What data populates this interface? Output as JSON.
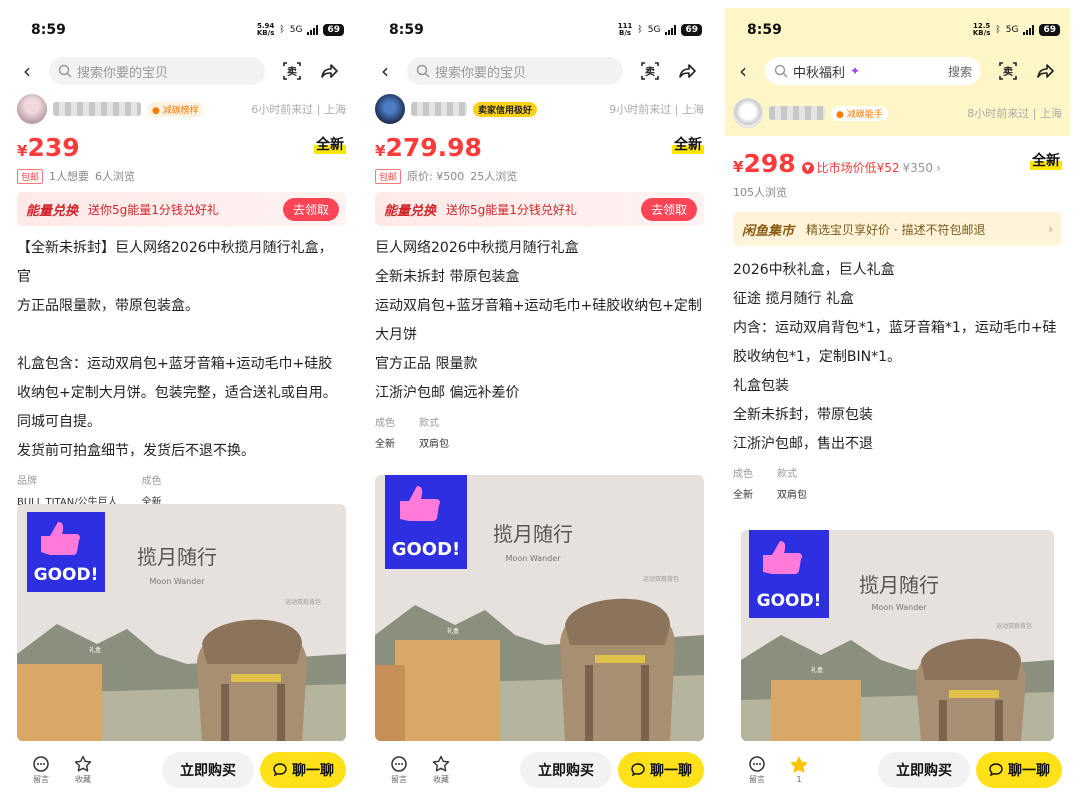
{
  "panels": [
    {
      "status": {
        "time": "8:59",
        "speed": "5.94",
        "speed_unit": "KB/s",
        "battery": "69",
        "network": "5G"
      },
      "search": {
        "placeholder": "搜索你要的宝贝",
        "query": ""
      },
      "seller": {
        "badge": "减碳榜样",
        "badge_color": "#ff7a00",
        "meta": "6小时前来过 | 上海"
      },
      "price": {
        "symbol": "¥",
        "value": "239"
      },
      "condition": "全新",
      "sub": {
        "tag": "包邮",
        "texts": [
          "1人想要",
          "6人浏览"
        ]
      },
      "banner": {
        "title": "能量兑换",
        "text": "送你5g能量1分钱兑好礼",
        "button": "去领取"
      },
      "description": [
        "【全新未拆封】巨人网络2026中秋揽月随行礼盒，官",
        "方正品限量款，带原包装盒。",
        "",
        "礼盒包含：运动双肩包+蓝牙音箱+运动毛巾+硅胶",
        "收纳包+定制大月饼。包装完整，适合送礼或自用。",
        "同城可自提。",
        "发货前可拍盒细节，发货后不退不换。"
      ],
      "attributes": [
        {
          "label": "品牌",
          "value": "BULL TITAN/公牛巨人"
        },
        {
          "label": "成色",
          "value": "全新"
        }
      ],
      "photo": {
        "good": "GOOD!",
        "title": "揽月随行",
        "subtitle": "Moon Wander",
        "label1": "运动双肩背包",
        "label2": "礼盒"
      },
      "bottom": {
        "comment": "留言",
        "favorite": "收藏",
        "buy": "立即购买",
        "chat": "聊一聊"
      }
    },
    {
      "status": {
        "time": "8:59",
        "speed": "111",
        "speed_unit": "B/s",
        "battery": "69",
        "network": "5G"
      },
      "search": {
        "placeholder": "搜索你要的宝贝",
        "query": ""
      },
      "seller": {
        "badge": "卖家信用极好",
        "badge_color": "#ffd21a",
        "meta": "9小时前来过 | 上海"
      },
      "price": {
        "symbol": "¥",
        "value": "279.98"
      },
      "condition": "全新",
      "sub": {
        "tag": "包邮",
        "texts": [
          "原价: ¥500",
          "25人浏览"
        ]
      },
      "banner": {
        "title": "能量兑换",
        "text": "送你5g能量1分钱兑好礼",
        "button": "去领取"
      },
      "description": [
        "巨人网络2026中秋揽月随行礼盒",
        "全新未拆封 带原包装盒",
        "运动双肩包+蓝牙音箱+运动毛巾+硅胶收纳包+定制",
        "大月饼",
        "官方正品 限量款",
        "江浙沪包邮 偏远补差价"
      ],
      "attributes": [
        {
          "label": "成色",
          "value": "全新"
        },
        {
          "label": "款式",
          "value": "双肩包"
        }
      ],
      "photo": {
        "good": "GOOD!",
        "title": "揽月随行",
        "subtitle": "Moon Wander",
        "label1": "运动双肩背包",
        "label2": "礼盒"
      },
      "bottom": {
        "comment": "留言",
        "favorite": "收藏",
        "buy": "立即购买",
        "chat": "聊一聊"
      }
    },
    {
      "status": {
        "time": "8:59",
        "speed": "12.5",
        "speed_unit": "KB/s",
        "battery": "69",
        "network": "5G"
      },
      "search": {
        "placeholder": "",
        "query": "中秋福利",
        "button": "搜索"
      },
      "seller": {
        "badge": "减碳能手",
        "badge_color": "#ff7a00",
        "meta": "8小时前来过 | 上海"
      },
      "price": {
        "symbol": "¥",
        "value": "298"
      },
      "compare": {
        "text": "比市场价低¥52",
        "strike": "¥350"
      },
      "condition": "全新",
      "sub": {
        "texts": [
          "105人浏览"
        ]
      },
      "banner": {
        "title": "闲鱼集市",
        "text": "精选宝贝享好价 · 描述不符包邮退"
      },
      "description": [
        "2026中秋礼盒，巨人礼盒",
        "征途 揽月随行 礼盒",
        "内含：运动双肩背包*1，蓝牙音箱*1，运动毛巾+硅",
        "胶收纳包*1，定制BIN*1。",
        "礼盒包装",
        "全新未拆封，带原包装",
        "江浙沪包邮，售出不退"
      ],
      "attributes": [
        {
          "label": "成色",
          "value": "全新"
        },
        {
          "label": "款式",
          "value": "双肩包"
        }
      ],
      "photo": {
        "good": "GOOD!",
        "title": "揽月随行",
        "subtitle": "Moon Wander",
        "label1": "运动双肩背包",
        "label2": "礼盒"
      },
      "bottom": {
        "comment": "留言",
        "favorite": "1",
        "buy": "立即购买",
        "chat": "聊一聊"
      }
    }
  ],
  "colors": {
    "price_red": "#ff3a3a",
    "chat_yellow": "#ffe11a",
    "panel3_header": "#fff6c8",
    "good_blue": "#2d2fe0",
    "good_thumb": "#ff7ad9"
  }
}
